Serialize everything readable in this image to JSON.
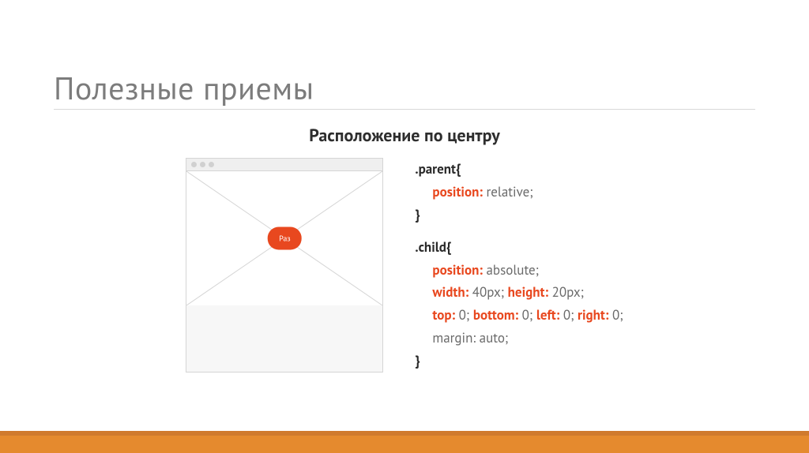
{
  "title": "Полезные приемы",
  "subtitle": "Расположение по центру",
  "diagram": {
    "child_label": "Раз"
  },
  "code": {
    "parent": {
      "selector": ".parent{",
      "line1_prop": "position:",
      "line1_val": " relative;",
      "close": "}"
    },
    "child": {
      "selector": ".child{",
      "line1_prop": "position:",
      "line1_val": " absolute;",
      "line2_prop1": "width:",
      "line2_val1": " 40px; ",
      "line2_prop2": "height:",
      "line2_val2": " 20px;",
      "line3_prop1": "top:",
      "line3_val1": " 0; ",
      "line3_prop2": "bottom:",
      "line3_val2": " 0; ",
      "line3_prop3": "left:",
      "line3_val3": " 0; ",
      "line3_prop4": "right:",
      "line3_val4": " 0;",
      "line4": "margin: auto;",
      "close": "}"
    }
  }
}
